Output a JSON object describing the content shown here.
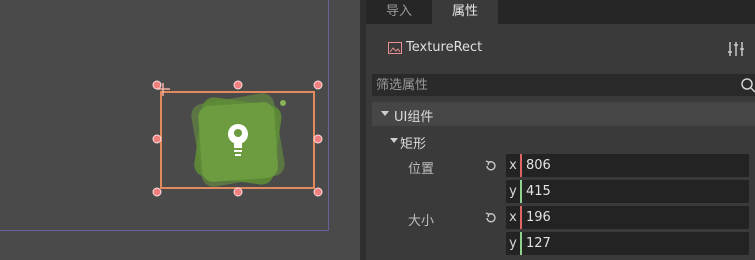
{
  "colors": {
    "selection_rect": "#e08a5e",
    "handle_fill": "#f08080",
    "texture_green": "#6a9a3e",
    "x_axis": "#e06666",
    "y_axis": "#8fd18f"
  },
  "viewport": {
    "node_icon": "godot-lightbulb-icon"
  },
  "inspector": {
    "tabs": [
      {
        "label": "导入",
        "active": false
      },
      {
        "label": "属性",
        "active": true
      }
    ],
    "node": {
      "name": "TextureRect",
      "icon": "texture-rect-icon"
    },
    "filter": {
      "placeholder": "筛选属性"
    },
    "sections": {
      "ui": "UI组件",
      "rect": "矩形"
    },
    "position": {
      "label": "位置",
      "x": "806",
      "y": "415"
    },
    "size": {
      "label": "大小",
      "x": "196",
      "y": "127"
    }
  }
}
